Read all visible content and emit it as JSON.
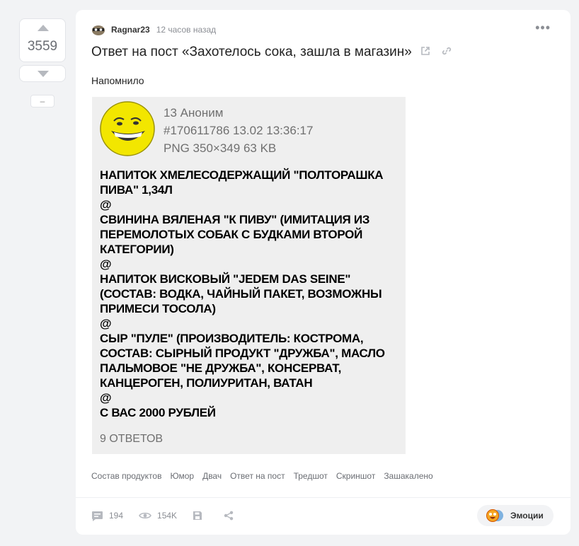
{
  "vote": {
    "rating": "3559",
    "collapse_label": "–"
  },
  "post": {
    "author": "Ragnar23",
    "time": "12 часов назад",
    "more": "•••",
    "title": "Ответ на пост «Захотелось сока, зашла в магазин»",
    "text": "Напомнило"
  },
  "image": {
    "meta": [
      "13 Аноним",
      "#170611786 13.02 13:36:17",
      "PNG 350×349 63 KB"
    ],
    "lines": [
      "НАПИТОК ХМЕЛЕСОДЕРЖАЩИЙ \"ПОЛТОРАШКА",
      "ПИВА\" 1,34Л",
      "@",
      "СВИНИНА ВЯЛЕНАЯ \"К ПИВУ\" (ИМИТАЦИЯ ИЗ",
      "ПЕРЕМОЛОТЫХ СОБАК С БУДКАМИ ВТОРОЙ",
      "КАТЕГОРИИ)",
      "@",
      "НАПИТОК ВИСКОВЫЙ \"JEDEM DAS SEINE\"",
      "(СОСТАВ: ВОДКА, ЧАЙНЫЙ ПАКЕТ, ВОЗМОЖНЫ",
      "ПРИМЕСИ ТОСОЛА)",
      "@",
      "СЫР \"ПУЛЕ\" (ПРОИЗВОДИТЕЛЬ: КОСТРОМА,",
      "СОСТАВ: СЫРНЫЙ ПРОДУКТ \"ДРУЖБА\", МАСЛО",
      "ПАЛЬМОВОЕ \"НЕ ДРУЖБА\", КОНСЕРВАТ,",
      "КАНЦЕРОГЕН, ПОЛИУРИТАН, ВАТАН",
      "@",
      "С ВАС 2000 РУБЛЕЙ"
    ],
    "replies": "9 ОТВЕТОВ"
  },
  "tags": [
    "Состав продуктов",
    "Юмор",
    "Двач",
    "Ответ на пост",
    "Тредшот",
    "Скриншот",
    "Зашакалено"
  ],
  "footer": {
    "comments": "194",
    "views": "154K",
    "emotions_label": "Эмоции"
  }
}
